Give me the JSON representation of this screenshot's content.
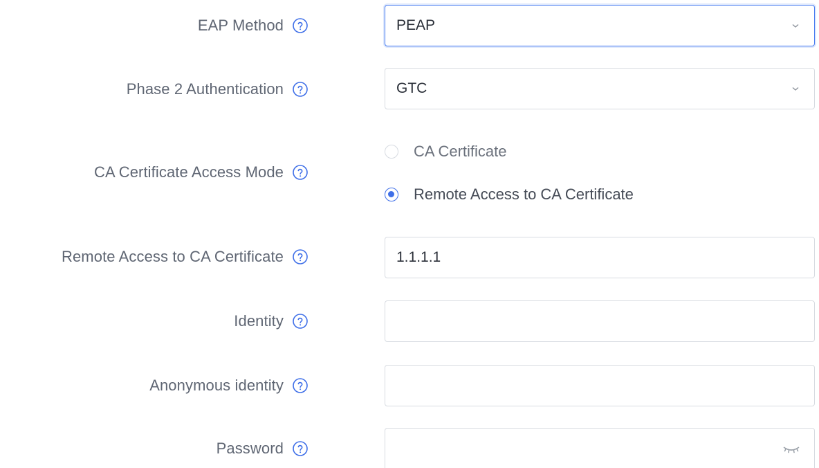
{
  "form": {
    "eap_method": {
      "label": "EAP Method",
      "value": "PEAP"
    },
    "phase2": {
      "label": "Phase 2 Authentication",
      "value": "GTC"
    },
    "ca_mode": {
      "label": "CA Certificate Access Mode",
      "options": [
        "CA Certificate",
        "Remote Access to CA Certificate"
      ],
      "selected": "Remote Access to CA Certificate"
    },
    "remote_ca": {
      "label": "Remote Access to CA Certificate",
      "value": "1.1.1.1"
    },
    "identity": {
      "label": "Identity",
      "value": ""
    },
    "anonymous_identity": {
      "label": "Anonymous identity",
      "value": ""
    },
    "password": {
      "label": "Password",
      "value": ""
    }
  },
  "colors": {
    "accent": "#3f6fe8",
    "label": "#5f6673",
    "border": "#d7dbe1"
  },
  "icons": {
    "help": "question-circle-icon",
    "dropdown": "chevron-down-icon",
    "password_toggle": "eye-closed-icon"
  }
}
